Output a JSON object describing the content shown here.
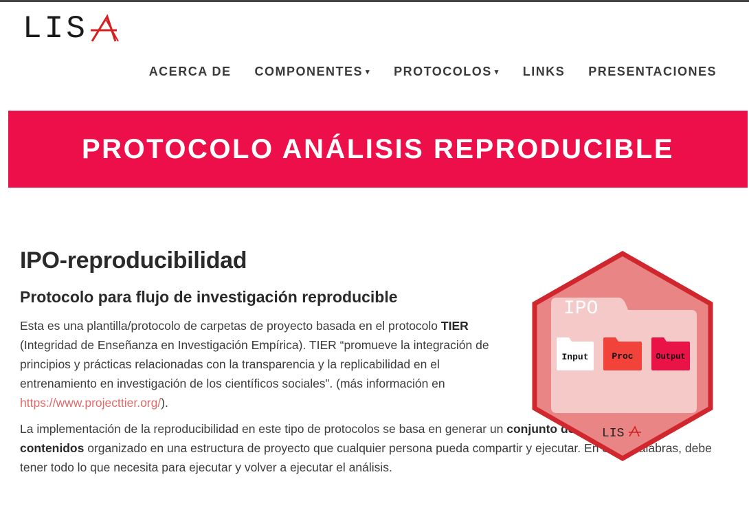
{
  "brand": {
    "logo_text": "LIS",
    "logo_mark": "A"
  },
  "nav": {
    "items": [
      {
        "label": "ACERCA DE",
        "dropdown": false
      },
      {
        "label": "COMPONENTES",
        "dropdown": true
      },
      {
        "label": "PROTOCOLOS",
        "dropdown": true
      },
      {
        "label": "LINKS",
        "dropdown": false
      },
      {
        "label": "PRESENTACIONES",
        "dropdown": false
      }
    ],
    "caret": "▾"
  },
  "banner": {
    "title": "PROTOCOLO ANÁLISIS REPRODUCIBLE",
    "color": "#ec0f4a"
  },
  "main": {
    "heading": "IPO-reproducibilidad",
    "subheading": "Protocolo para flujo de investigación reproducible",
    "p1": {
      "t1": "Esta es una plantilla/protocolo de carpetas de proyecto basada en el protocolo ",
      "b1": "TIER",
      "t2": " (Integridad de Enseñanza en Investigación Empírica). TIER “promueve la integración de principios y prácticas relacionadas con la transparencia y la replicabilidad en el entrenamiento en investigación de los científicos sociales”. (más información en ",
      "link": "https://www.projecttier.org/",
      "t3": ")."
    },
    "p2": {
      "t1": "La implementación de la reproducibilidad en este tipo de protocolos se basa en generar un ",
      "b1": "conjunto de archivos auto-contenidos",
      "t2": " organizado en una estructura de proyecto que cualquier persona pueda compartir y ejecutar. En otras palabras, debe tener todo lo que necesita para ejecutar y volver a ejecutar el análisis."
    }
  },
  "hex_logo": {
    "title": "IPO",
    "folders": [
      "Input",
      "Proc",
      "Output"
    ],
    "brand": "LIS",
    "brand_mark": "A",
    "colors": {
      "border": "#d0262e",
      "fill": "#ea8585",
      "folder": "#f6c9c9",
      "input": "#ffffff",
      "proc": "#f2433a",
      "output": "#ea1347"
    }
  }
}
